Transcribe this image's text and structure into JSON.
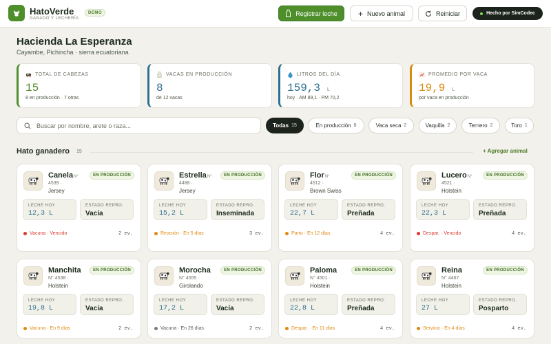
{
  "app": {
    "name": "HatoVerde",
    "subtitle": "GANADO Y LECHERÍA",
    "badge": "DEMO"
  },
  "header": {
    "register_milk": "Registrar leche",
    "new_animal": "Nuevo animal",
    "reset": "Reiniciar",
    "made_by": "Hecho por SimCodec"
  },
  "farm": {
    "name": "Hacienda La Esperanza",
    "location": "Cayambe, Pichincha · sierra ecuatoriana"
  },
  "stats": [
    {
      "label": "TOTAL DE CABEZAS",
      "value": "15",
      "unit": "",
      "sub": "8 en producción · 7 otras",
      "color": "#4e8f2c",
      "icon": "cow-icon"
    },
    {
      "label": "VACAS EN PRODUCCIÓN",
      "value": "8",
      "unit": "",
      "sub": "de 12 vacas",
      "color": "#2c6f8f",
      "icon": "milk-bottle-icon"
    },
    {
      "label": "LITROS DEL DÍA",
      "value": "159,3",
      "unit": "L",
      "sub": "hoy · AM 89,1 · PM 70,2",
      "color": "#2c6f8f",
      "icon": "droplet-icon"
    },
    {
      "label": "PROMEDIO POR VACA",
      "value": "19,9",
      "unit": "L",
      "sub": "por vaca en producción",
      "color": "#d98a12",
      "icon": "chart-up-icon"
    }
  ],
  "search": {
    "placeholder": "Buscar por nombre, arete o raza..."
  },
  "filters": [
    {
      "label": "Todas",
      "count": "15",
      "active": true
    },
    {
      "label": "En producción",
      "count": "8",
      "active": false
    },
    {
      "label": "Vaca seca",
      "count": "2",
      "active": false
    },
    {
      "label": "Vaquilla",
      "count": "2",
      "active": false
    },
    {
      "label": "Ternero",
      "count": "2",
      "active": false
    },
    {
      "label": "Toro",
      "count": "1",
      "active": false
    }
  ],
  "section": {
    "title": "Hato ganadero",
    "count": "15",
    "add_label": "+ Agregar animal"
  },
  "labels": {
    "milk_today": "LECHE HOY",
    "repro_state": "ESTADO REPRO.",
    "no": "N°"
  },
  "colors": {
    "red": "#d63b2f",
    "orange": "#e08a12",
    "gray": "#7b7d72"
  },
  "animals": [
    {
      "name": "Canela",
      "id": "4539 ·",
      "breed": "Jersey",
      "status": "EN PRODUCCIÓN",
      "milk": "12,3 L",
      "repro": "Vacía",
      "alert": "Vacuna · Vencido",
      "alert_color": "red",
      "events": "2 ev."
    },
    {
      "name": "Estrella",
      "id": "4488 ·",
      "breed": "Jersey",
      "status": "EN PRODUCCIÓN",
      "milk": "15,2 L",
      "repro": "Inseminada",
      "alert": "Revisión · En 5 días",
      "alert_color": "orange",
      "events": "3 ev."
    },
    {
      "name": "Flor",
      "id": "4512 ·",
      "breed": "Brown Swiss",
      "status": "EN PRODUCCIÓN",
      "milk": "22,7 L",
      "repro": "Preñada",
      "alert": "Parto · En 12 días",
      "alert_color": "orange",
      "events": "4 ev."
    },
    {
      "name": "Lucero",
      "id": "4521 ·",
      "breed": "Holstein",
      "status": "EN PRODUCCIÓN",
      "milk": "22,3 L",
      "repro": "Preñada",
      "alert": "Despar. · Vencido",
      "alert_color": "red",
      "events": "4 ev."
    },
    {
      "name": "Manchita",
      "id": "N° 4538 ·",
      "breed": "Holstein",
      "status": "EN PRODUCCIÓN",
      "milk": "19,8 L",
      "repro": "Vacía",
      "alert": "Vacuna · En 9 días",
      "alert_color": "orange",
      "events": "2 ev."
    },
    {
      "name": "Morocha",
      "id": "N° 4555 ·",
      "breed": "Girolando",
      "status": "EN PRODUCCIÓN",
      "milk": "17,2 L",
      "repro": "Vacía",
      "alert": "Vacuna · En 26 días",
      "alert_color": "gray",
      "events": "2 ev."
    },
    {
      "name": "Paloma",
      "id": "N° 4501 ·",
      "breed": "Holstein",
      "status": "EN PRODUCCIÓN",
      "milk": "22,8 L",
      "repro": "Preñada",
      "alert": "Despar. · En 11 días",
      "alert_color": "orange",
      "events": "4 ev."
    },
    {
      "name": "Reina",
      "id": "N° 4467 ·",
      "breed": "Holstein",
      "status": "EN PRODUCCIÓN",
      "milk": "27 L",
      "repro": "Posparto",
      "alert": "Servicio · En 4 días",
      "alert_color": "orange",
      "events": "4 ev."
    }
  ]
}
